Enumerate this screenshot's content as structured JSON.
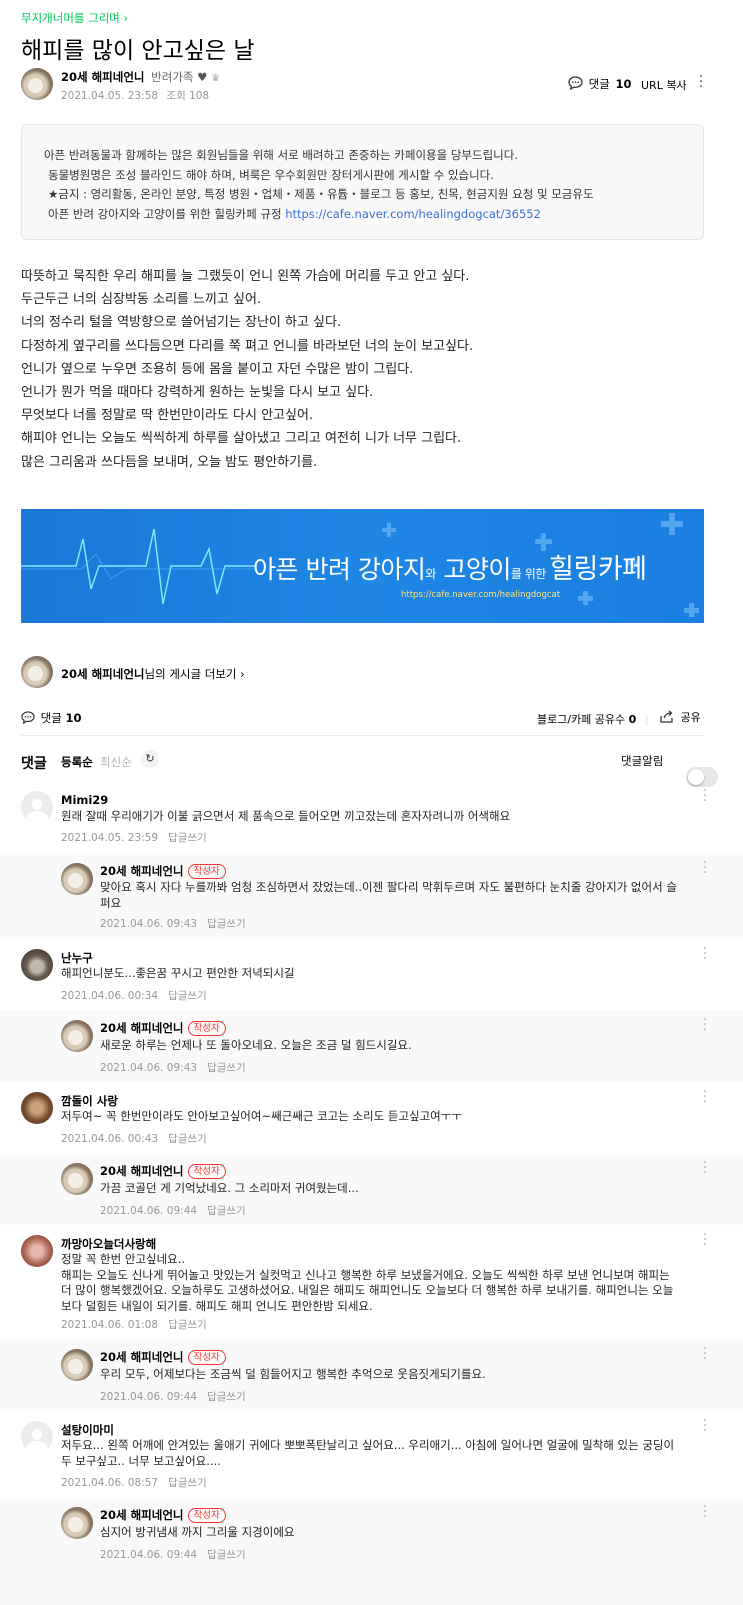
{
  "header": {
    "board_link": "무지개너머를 그리며",
    "title": "해피를 많이 안고싶은 날",
    "author_name": "20세 해피네언니",
    "author_level": "반려가족",
    "date": "2021.04.05. 23:58",
    "views": "조회 108",
    "comment_label": "댓글",
    "comment_count": "10",
    "url_copy": "URL 복사"
  },
  "notice": {
    "lines": [
      "아픈 반려동물과 함께하는 많은 회원님들을 위해 서로 배려하고 존중하는 카페이용을 당부드립니다.",
      "동물병원명은 조성 블라인드 해야 하며, 벼룩은 우수회원만 장터게시판에 게시할 수 있습니다.",
      "★금지 : 영리활동, 온라인 분양, 특정 병원・업체・제품・유튭・블로그 등 홍보, 친목, 현금지원 요청 및 모금유도"
    ],
    "last_line_prefix": "아픈 반려 강아지와 고양이를 위한 힐링카페 규정",
    "last_line_link": "https://cafe.naver.com/healingdogcat/36552"
  },
  "body": {
    "lines": [
      "따뜻하고 묵직한 우리 해피를 늘 그랬듯이 언니 왼쪽 가슴에 머리를 두고 안고 싶다.",
      "두근두근 너의 심장박동 소리를 느끼고 싶어.",
      "너의 정수리 털을 역방향으로 쓸어넘기는 장난이 하고 싶다.",
      "다정하게 옆구리를 쓰다듬으면 다리를 쭉 펴고 언니를 바라보던 너의 눈이 보고싶다.",
      "언니가 옆으로 누우면 조용히 등에 몸을 붙이고 자던 수많은 밤이 그립다.",
      "언니가 뭔가 먹을 때마다 강력하게 원하는 눈빛을 다시 보고 싶다.",
      "무엇보다 너를 정말로 딱 한번만이라도 다시 안고싶어.",
      "해피야 언니는 오늘도 씩씩하게 하루를 살아냈고 그리고 여전히 니가 너무 그립다.",
      "많은 그리움과 쓰다듬을 보내며, 오늘 밤도 평안하기를."
    ]
  },
  "banner": {
    "title_1": "아픈 반려 강아지",
    "title_2": "와",
    "title_3": " 고양이",
    "title_4": "를 위한 ",
    "title_5": "힐링카페",
    "url": "https://cafe.naver.com/healingdogcat"
  },
  "author_more": {
    "name": "20세 해피네언니",
    "suffix": "님의 게시글 더보기"
  },
  "stats": {
    "comment_label": "댓글",
    "comment_count": "10",
    "share_count_label": "블로그/카페 공유수",
    "share_count": "0",
    "share_label": "공유"
  },
  "comments_header": {
    "title": "댓글",
    "sort_registered": "등록순",
    "sort_latest": "최신순",
    "alarm_label": "댓글알림"
  },
  "reply_label": "답글쓰기",
  "writer_badge": "작성자",
  "comments": [
    {
      "name": "Mimi29",
      "text": "원래 잘때 우리애기가 이불 긁으면서 제 품속으로 들어오면 끼고잤는데 혼자자려니까 어색해요",
      "date": "2021.04.05. 23:59"
    },
    {
      "name": "20세 해피네언니",
      "text": "맞아요 혹시 자다 누를까봐 엄청 조심하면서 잤었는데..이젠 팔다리 막휘두르며 자도 불편하다 눈치줄 강아지가 없어서 슬퍼요",
      "date": "2021.04.06. 09:43"
    },
    {
      "name": "난누구",
      "text": "해피언니분도...좋은꿈 꾸시고 편안한 저녁되시길",
      "date": "2021.04.06. 00:34"
    },
    {
      "name": "20세 해피네언니",
      "text": "새로운 하루는 언제나 또 돌아오네요. 오늘은 조금 덜 힘드시길요.",
      "date": "2021.04.06. 09:43"
    },
    {
      "name": "깜돌이 사랑",
      "text": "저두여~ 꼭 한번만이라도 안아보고싶어여~쌔근쌔근 코고는 소리도 듣고싶고여ㅜㅜ",
      "date": "2021.04.06. 00:43"
    },
    {
      "name": "20세 해피네언니",
      "text": "가끔 코골던 게 기억났네요. 그 소리마저 귀여웠는데...",
      "date": "2021.04.06. 09:44"
    },
    {
      "name": "까망아오늘더사랑해",
      "text": "정말 꼭 한번 안고싶네요..\n해피는 오늘도 신나게 뛰어놀고 맛있는거 실컷먹고 신나고 행복한 하루 보냈을거에요. 오늘도 씩씩한 하루 보낸 언니보며 해피는 더 많이 행복했겠어요. 오늘하루도 고생하셨어요. 내일은 해피도 해피언니도 오늘보다 더 행복한 하루 보내기를. 해피언니는 오늘보다 덜힘든 내일이 되기를. 해피도 해피 언니도 편안한밤 되세요.",
      "date": "2021.04.06. 01:08"
    },
    {
      "name": "20세 해피네언니",
      "text": "우리 모두, 어제보다는 조금씩 덜 힘들어지고 행복한 추억으로 웃음짓게되기를요.",
      "date": "2021.04.06. 09:44"
    },
    {
      "name": "설탕이마미",
      "text": "저두요... 왼쪽 어깨에 안겨있는 울애기 귀에다 뽀뽀폭탄날리고 싶어요... 우리애기... 아침에 일어나면 얼굴에 밀착해 있는 궁딩이두 보구싶고.. 너무 보고싶어요....",
      "date": "2021.04.06. 08:57"
    },
    {
      "name": "20세 해피네언니",
      "text": "심지어 방귀냄새 까지 그리울 지경이에요",
      "date": "2021.04.06. 09:44"
    }
  ]
}
